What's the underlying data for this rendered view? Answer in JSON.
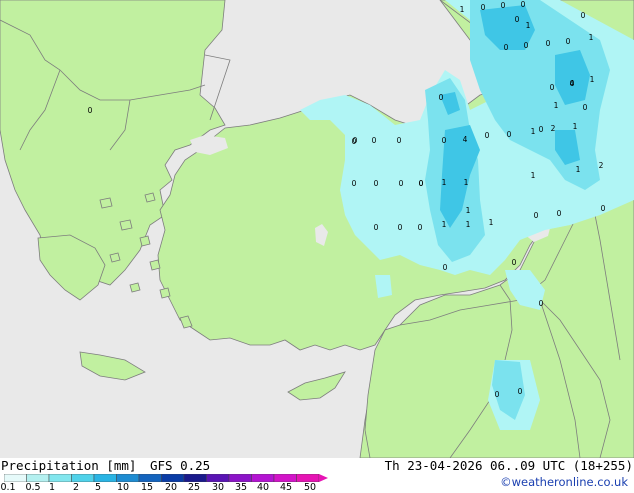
{
  "map": {
    "colors": {
      "sea": "#e9e9e9",
      "land": "#c1f0a0",
      "border": "#7d7d7d",
      "precip_light": "#b0f5f5",
      "precip_mid": "#7be2ee",
      "precip_heavy": "#3fc6e6"
    },
    "values": [
      {
        "id": "v1",
        "label": "1"
      },
      {
        "id": "v2",
        "label": "0"
      },
      {
        "id": "v3",
        "label": "0"
      },
      {
        "id": "v4",
        "label": "0"
      },
      {
        "id": "v5",
        "label": "0"
      },
      {
        "id": "v6",
        "label": "0"
      },
      {
        "id": "v7",
        "label": "1"
      },
      {
        "id": "v8",
        "label": "0"
      },
      {
        "id": "v9",
        "label": "0"
      },
      {
        "id": "v10",
        "label": "0"
      },
      {
        "id": "v11",
        "label": "0"
      },
      {
        "id": "v12",
        "label": "1"
      },
      {
        "id": "v13",
        "label": "1"
      },
      {
        "id": "v14",
        "label": "0"
      },
      {
        "id": "v15",
        "label": "0"
      },
      {
        "id": "v16",
        "label": "0"
      },
      {
        "id": "v17",
        "label": "0"
      },
      {
        "id": "v18",
        "label": "0"
      },
      {
        "id": "v19",
        "label": "4"
      },
      {
        "id": "v20",
        "label": "0"
      },
      {
        "id": "v21",
        "label": "0"
      },
      {
        "id": "v22",
        "label": "1"
      },
      {
        "id": "v23",
        "label": "2"
      },
      {
        "id": "v24",
        "label": "1"
      },
      {
        "id": "v25",
        "label": "2"
      },
      {
        "id": "v26",
        "label": "0"
      },
      {
        "id": "v27",
        "label": "0"
      },
      {
        "id": "v28",
        "label": "0"
      },
      {
        "id": "v29",
        "label": "0"
      },
      {
        "id": "v30",
        "label": "1"
      },
      {
        "id": "v31",
        "label": "1"
      },
      {
        "id": "v32",
        "label": "1"
      },
      {
        "id": "v33",
        "label": "1"
      },
      {
        "id": "v34",
        "label": "0"
      },
      {
        "id": "v35",
        "label": "0"
      },
      {
        "id": "v36",
        "label": "0"
      },
      {
        "id": "v37",
        "label": "0"
      },
      {
        "id": "v38",
        "label": "0"
      },
      {
        "id": "v39",
        "label": "0"
      },
      {
        "id": "v40",
        "label": "0"
      },
      {
        "id": "v41",
        "label": "0"
      },
      {
        "id": "v42",
        "label": "0"
      },
      {
        "id": "v43",
        "label": "0"
      },
      {
        "id": "v44",
        "label": "0"
      },
      {
        "id": "v45",
        "label": "0"
      },
      {
        "id": "v46",
        "label": "0"
      },
      {
        "id": "v47",
        "label": "0"
      },
      {
        "id": "v48",
        "label": "1"
      },
      {
        "id": "v49",
        "label": "1"
      },
      {
        "id": "v50",
        "label": "1"
      },
      {
        "id": "v51",
        "label": "1"
      },
      {
        "id": "v52",
        "label": "0"
      },
      {
        "id": "v53",
        "label": "0"
      },
      {
        "id": "v54",
        "label": "0"
      },
      {
        "id": "v55",
        "label": "4"
      },
      {
        "id": "v56",
        "label": "1"
      },
      {
        "id": "v57",
        "label": "0"
      }
    ]
  },
  "footer": {
    "title": "Precipitation [mm]",
    "model": "GFS 0.25",
    "run": "Th 23-04-2026 06..09 UTC (18+255)",
    "credit": "©weatheronline.co.uk"
  },
  "legend": {
    "ticks": [
      "0.1",
      "0.5",
      "1",
      "2",
      "5",
      "10",
      "15",
      "20",
      "25",
      "30",
      "35",
      "40",
      "45",
      "50"
    ],
    "colors": [
      "#e6fafa",
      "#b4f0f0",
      "#82e6ee",
      "#50d2ea",
      "#2ab4e4",
      "#1e8cd2",
      "#1464be",
      "#0a3ca6",
      "#1a1a8c",
      "#5a14b4",
      "#8c14c8",
      "#b414d2",
      "#d214c8",
      "#e614b4"
    ]
  }
}
